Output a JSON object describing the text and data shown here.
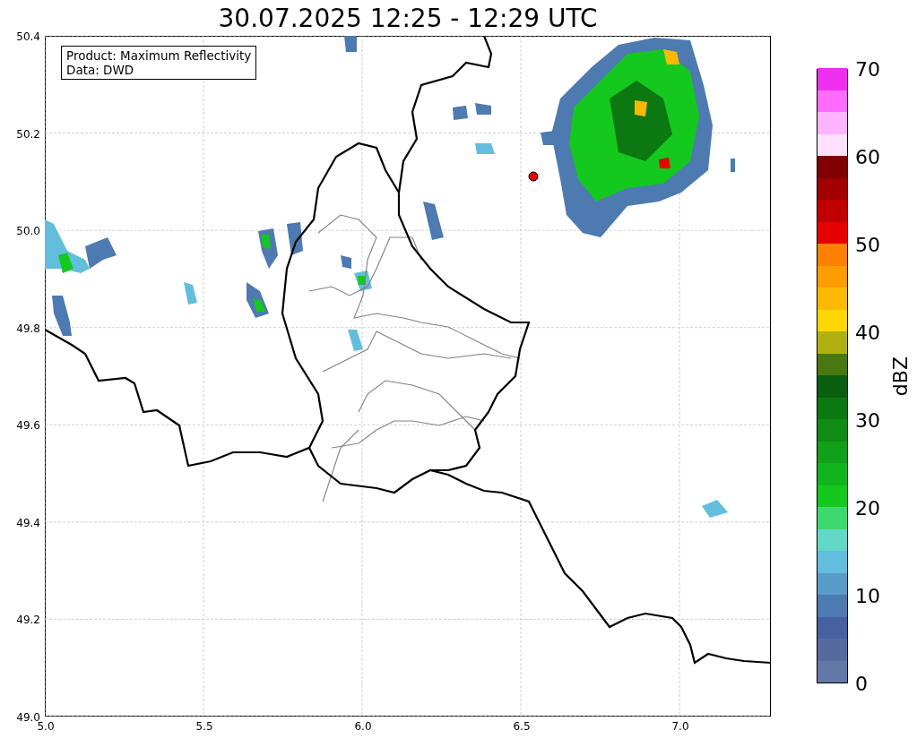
{
  "title": "30.07.2025 12:25 - 12:29 UTC",
  "info_box": [
    "Product: Maximum Reflectivity",
    "Data: DWD"
  ],
  "map": {
    "xticks": [
      "5.0",
      "5.5",
      "6.0",
      "6.5",
      "7.0"
    ],
    "yticks": [
      "50.4",
      "50.2",
      "50.0",
      "49.8",
      "49.6",
      "49.4",
      "49.2",
      "49.0"
    ]
  },
  "colorbar": {
    "label": "dBZ",
    "ticks": [
      "70",
      "60",
      "50",
      "40",
      "30",
      "20",
      "10",
      "0"
    ],
    "bins": [
      {
        "color": "#6478a8"
      },
      {
        "color": "#566aa0"
      },
      {
        "color": "#4660a0"
      },
      {
        "color": "#4d7ab0"
      },
      {
        "color": "#5a9cc8"
      },
      {
        "color": "#62bedc"
      },
      {
        "color": "#62d8c8"
      },
      {
        "color": "#3ed870"
      },
      {
        "color": "#14c81e"
      },
      {
        "color": "#12b41e"
      },
      {
        "color": "#10a01a"
      },
      {
        "color": "#0e8c14"
      },
      {
        "color": "#0c7812"
      },
      {
        "color": "#0a5e10"
      },
      {
        "color": "#4a7810"
      },
      {
        "color": "#b0b010"
      },
      {
        "color": "#ffd700"
      },
      {
        "color": "#ffb800"
      },
      {
        "color": "#ff9c00"
      },
      {
        "color": "#ff8000"
      },
      {
        "color": "#e60000"
      },
      {
        "color": "#c00000"
      },
      {
        "color": "#a00000"
      },
      {
        "color": "#800000"
      },
      {
        "color": "#ffe0ff"
      },
      {
        "color": "#ffb4ff"
      },
      {
        "color": "#ff6cff"
      },
      {
        "color": "#ee30ee"
      }
    ]
  }
}
